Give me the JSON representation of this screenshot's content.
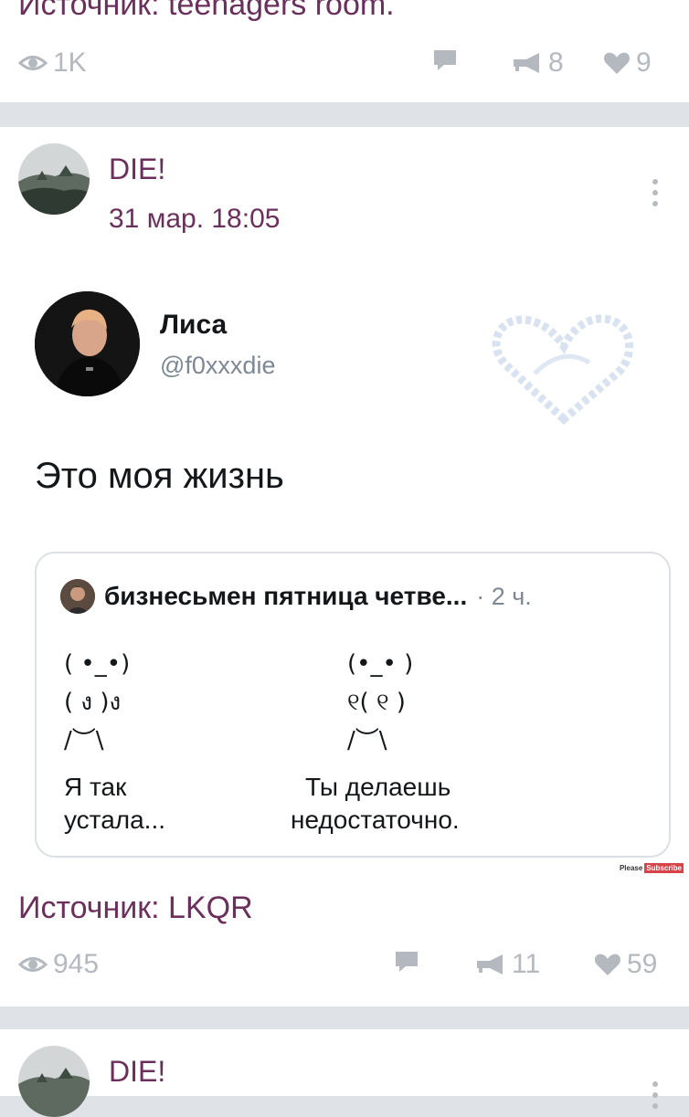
{
  "prev_post": {
    "source_text": "Источник: teenagers room.",
    "views": "1K",
    "reposts": "8",
    "likes": "9"
  },
  "post": {
    "author": "DIE!",
    "date": "31 мар. 18:05",
    "tweet": {
      "name": "Лиса",
      "handle": "@f0xxxdie",
      "text": "Это моя жизнь",
      "quote": {
        "name": "бизнесьмен пятница четве...",
        "time": "· 2 ч.",
        "left_art": "( •_•)\n( ง )ง\n/︶\\",
        "right_art": "(•_• )\n୧( ୧ )\n/︶\\",
        "left_caption_1": "Я так",
        "left_caption_2": "устала...",
        "right_caption_1": "Ты делаешь",
        "right_caption_2": "недостаточно."
      },
      "badge_please": "Please",
      "badge_subscribe": "Subscribe"
    },
    "source_text": "Источник: LKQR",
    "views": "945",
    "reposts": "11",
    "likes": "59"
  },
  "next_post": {
    "author": "DIE!"
  },
  "colors": {
    "accent": "#6b2f5b",
    "muted": "#b4b9bf",
    "background": "#dfe3e8"
  },
  "icons": [
    "eye-icon",
    "comment-icon",
    "repost-icon",
    "heart-icon",
    "more-icon"
  ]
}
